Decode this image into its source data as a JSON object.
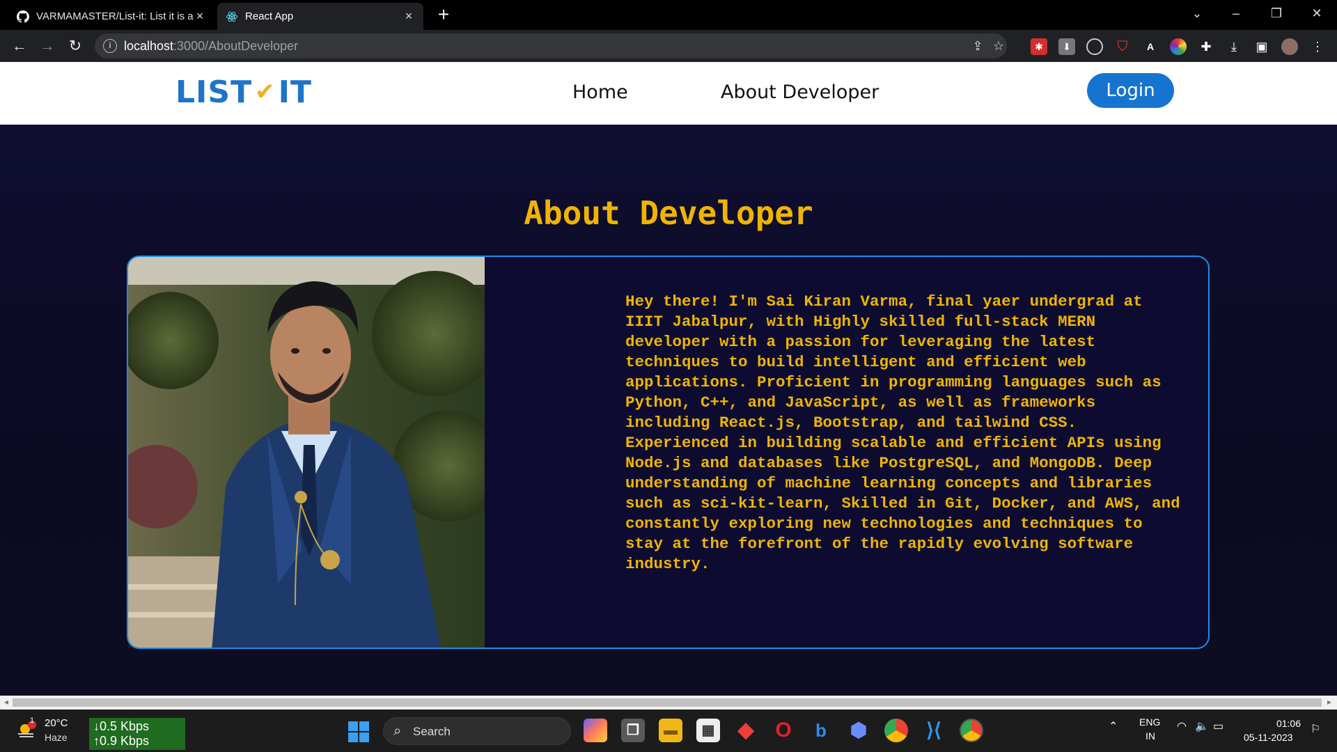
{
  "browser": {
    "tabs": [
      {
        "title": "VARMAMASTER/List-it: List it is a",
        "active": false,
        "icon": "github-icon"
      },
      {
        "title": "React App",
        "active": true,
        "icon": "react-icon"
      }
    ],
    "url_host": "localhost",
    "url_path": ":3000/AboutDeveloper"
  },
  "site": {
    "logo_left": "LIST",
    "logo_right": "IT",
    "nav": {
      "home": "Home",
      "about": "About Developer"
    },
    "login_label": "Login",
    "accent": "#f0b400",
    "brand_blue": "#1674d1"
  },
  "about": {
    "title": "About Developer",
    "bio": "Hey there! I'm Sai Kiran Varma, final yaer undergrad at IIIT Jabalpur, with Highly skilled full-stack MERN developer with a passion for leveraging the latest techniques to build intelligent and efficient web applications. Proficient in programming languages such as Python, C++, and JavaScript, as well as frameworks including React.js, Bootstrap, and tailwind CSS. Experienced in building scalable and efficient APIs using Node.js and databases like PostgreSQL, and MongoDB. Deep understanding of machine learning concepts and libraries such as sci-kit-learn, Skilled in Git, Docker, and AWS, and constantly exploring new technologies and techniques to stay at the forefront of the rapidly evolving software industry."
  },
  "taskbar": {
    "weather_temp": "20°C",
    "weather_cond": "Haze",
    "weather_badge": "1",
    "net_down": "↓0.5 Kbps",
    "net_up": "↑0.9 Kbps",
    "search_label": "Search",
    "lang_top": "ENG",
    "lang_bottom": "IN",
    "time": "01:06",
    "date": "05-11-2023"
  }
}
